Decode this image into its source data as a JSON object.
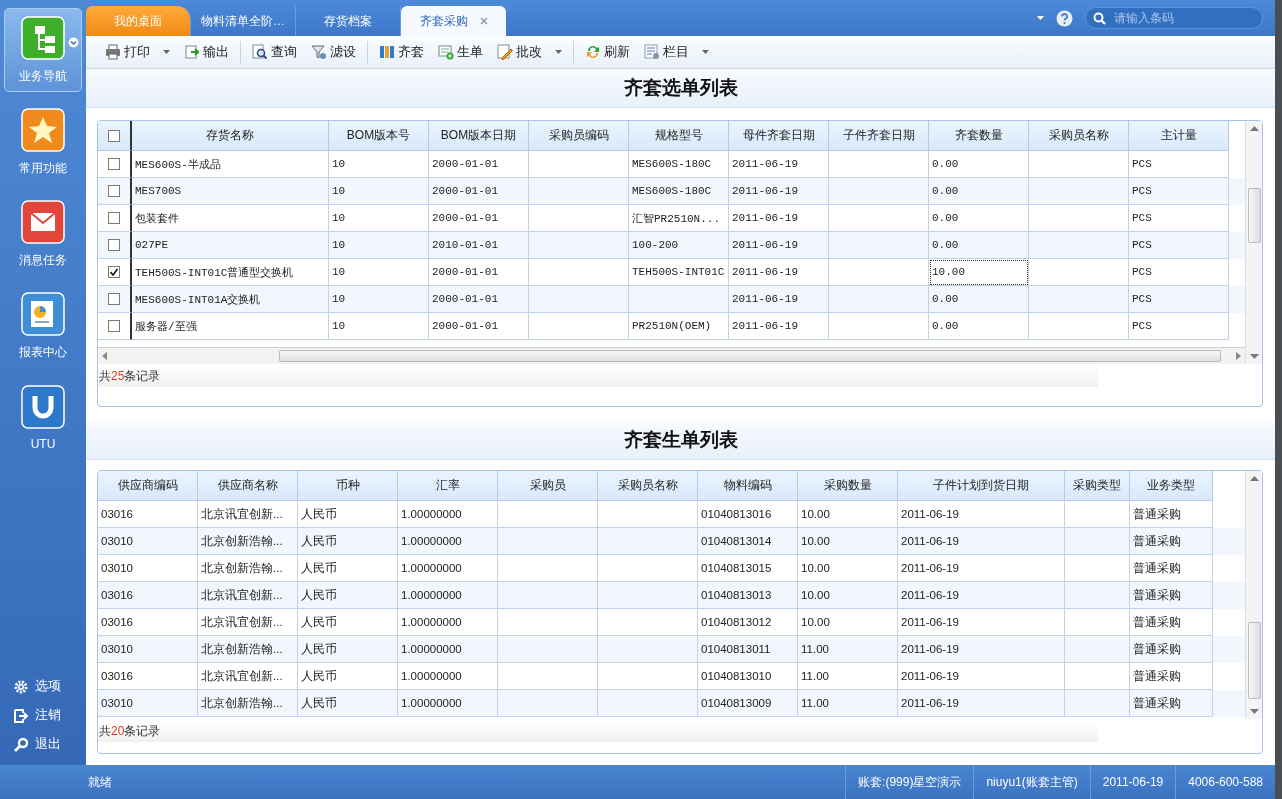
{
  "sidebar": {
    "items": [
      {
        "label": "业务导航",
        "selected": true
      },
      {
        "label": "常用功能",
        "selected": false
      },
      {
        "label": "消息任务",
        "selected": false
      },
      {
        "label": "报表中心",
        "selected": false
      },
      {
        "label": "UTU",
        "selected": false
      }
    ],
    "bottom_items": [
      {
        "label": "选项"
      },
      {
        "label": "注销"
      },
      {
        "label": "退出"
      }
    ]
  },
  "tabs": [
    {
      "label": "我的桌面",
      "kind": "home",
      "selected": false,
      "closable": false
    },
    {
      "label": "物料清单全阶…",
      "kind": "page",
      "selected": false,
      "closable": false
    },
    {
      "label": "存货档案",
      "kind": "page",
      "selected": false,
      "closable": false
    },
    {
      "label": "齐套采购",
      "kind": "page",
      "selected": true,
      "closable": true
    }
  ],
  "search": {
    "placeholder": "请输入条码"
  },
  "toolbar": [
    {
      "items": [
        {
          "label": "打印",
          "dropdown": true
        },
        {
          "label": "输出",
          "dropdown": false
        }
      ]
    },
    {
      "items": [
        {
          "label": "查询",
          "dropdown": false
        },
        {
          "label": "滤设",
          "dropdown": false
        }
      ]
    },
    {
      "items": [
        {
          "label": "齐套",
          "dropdown": false
        },
        {
          "label": "生单",
          "dropdown": false
        },
        {
          "label": "批改",
          "dropdown": true
        }
      ]
    },
    {
      "items": [
        {
          "label": "刷新",
          "dropdown": false
        },
        {
          "label": "栏目",
          "dropdown": true
        }
      ]
    }
  ],
  "selection_list": {
    "title": "齐套选单列表",
    "select_all": false,
    "columns": [
      "存货名称",
      "BOM版本号",
      "BOM版本日期",
      "采购员编码",
      "规格型号",
      "母件齐套日期",
      "子件齐套日期",
      "齐套数量",
      "采购员名称",
      "主计量"
    ],
    "rows": [
      {
        "checked": false,
        "qty_focused": false,
        "cells": [
          "MES600S-半成品",
          "10",
          "2000-01-01",
          null,
          "MES600S-180C",
          "2011-06-19",
          null,
          "0.00",
          null,
          "PCS"
        ]
      },
      {
        "checked": false,
        "qty_focused": false,
        "cells": [
          "MES700S",
          "10",
          "2000-01-01",
          null,
          "MES600S-180C",
          "2011-06-19",
          null,
          "0.00",
          null,
          "PCS"
        ]
      },
      {
        "checked": false,
        "qty_focused": false,
        "cells": [
          "包装套件",
          "10",
          "2000-01-01",
          null,
          "汇智PR2510N...",
          "2011-06-19",
          null,
          "0.00",
          null,
          "PCS"
        ]
      },
      {
        "checked": false,
        "qty_focused": false,
        "cells": [
          "027PE",
          "10",
          "2010-01-01",
          null,
          "100-200",
          "2011-06-19",
          null,
          "0.00",
          null,
          "PCS"
        ]
      },
      {
        "checked": true,
        "qty_focused": true,
        "cells": [
          "TEH500S-INT01C普通型交换机",
          "10",
          "2000-01-01",
          null,
          "TEH500S-INT01C",
          "2011-06-19",
          null,
          "10.00",
          null,
          "PCS"
        ]
      },
      {
        "checked": false,
        "qty_focused": false,
        "cells": [
          "MES600S-INT01A交换机",
          "10",
          "2000-01-01",
          null,
          null,
          "2011-06-19",
          null,
          "0.00",
          null,
          "PCS"
        ]
      },
      {
        "checked": false,
        "qty_focused": false,
        "cells": [
          "服务器/至强",
          "10",
          "2000-01-01",
          null,
          "PR2510N(OEM)",
          "2011-06-19",
          null,
          "0.00",
          null,
          "PCS"
        ]
      }
    ],
    "footer": {
      "before": "共",
      "count": "25",
      "after": "条记录"
    }
  },
  "order_list": {
    "title": "齐套生单列表",
    "columns": [
      "供应商编码",
      "供应商名称",
      "币种",
      "汇率",
      "采购员",
      "采购员名称",
      "物料编码",
      "采购数量",
      "子件计划到货日期",
      "采购类型",
      "业务类型"
    ],
    "rows": [
      [
        "03016",
        "北京讯宜创新...",
        "人民币",
        "1.00000000",
        null,
        null,
        "01040813016",
        "10.00",
        "2011-06-19",
        null,
        "普通采购"
      ],
      [
        "03010",
        "北京创新浩翰...",
        "人民币",
        "1.00000000",
        null,
        null,
        "01040813014",
        "10.00",
        "2011-06-19",
        null,
        "普通采购"
      ],
      [
        "03010",
        "北京创新浩翰...",
        "人民币",
        "1.00000000",
        null,
        null,
        "01040813015",
        "10.00",
        "2011-06-19",
        null,
        "普通采购"
      ],
      [
        "03016",
        "北京讯宜创新...",
        "人民币",
        "1.00000000",
        null,
        null,
        "01040813013",
        "10.00",
        "2011-06-19",
        null,
        "普通采购"
      ],
      [
        "03016",
        "北京讯宜创新...",
        "人民币",
        "1.00000000",
        null,
        null,
        "01040813012",
        "10.00",
        "2011-06-19",
        null,
        "普通采购"
      ],
      [
        "03010",
        "北京创新浩翰...",
        "人民币",
        "1.00000000",
        null,
        null,
        "01040813011",
        "11.00",
        "2011-06-19",
        null,
        "普通采购"
      ],
      [
        "03016",
        "北京讯宜创新...",
        "人民币",
        "1.00000000",
        null,
        null,
        "01040813010",
        "11.00",
        "2011-06-19",
        null,
        "普通采购"
      ],
      [
        "03010",
        "北京创新浩翰...",
        "人民币",
        "1.00000000",
        null,
        null,
        "01040813009",
        "11.00",
        "2011-06-19",
        null,
        "普通采购"
      ]
    ],
    "footer": {
      "before": "共",
      "count": "20",
      "after": "条记录"
    }
  },
  "status_bar": {
    "text": "就绪",
    "fields": [
      "账套:(999)星空演示",
      "niuyu1(账套主管)",
      "2011-06-19",
      "4006-600-588"
    ]
  }
}
